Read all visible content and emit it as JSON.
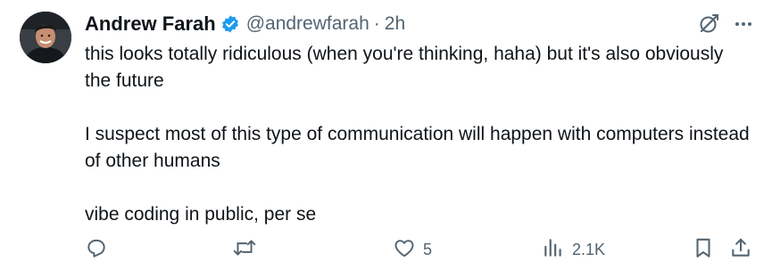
{
  "author": {
    "name": "Andrew Farah",
    "handle": "@andrewfarah",
    "separator": "·",
    "time": "2h",
    "verified": true,
    "avatar_icon": "profile-photo"
  },
  "tweet": {
    "paragraphs": [
      "this looks totally ridiculous (when you're thinking, haha) but it's also obviously the future",
      "I suspect most of this type of communication will happen with computers instead of other humans",
      "vibe coding in public, per se"
    ]
  },
  "top_actions": {
    "grok_icon": "grok-icon",
    "more_icon": "more-icon"
  },
  "metrics": {
    "replies": "",
    "reposts": "",
    "likes": "5",
    "views": "2.1K"
  },
  "colors": {
    "text": "#0f1419",
    "secondary": "#536471",
    "verified_blue": "#1d9bf0"
  }
}
